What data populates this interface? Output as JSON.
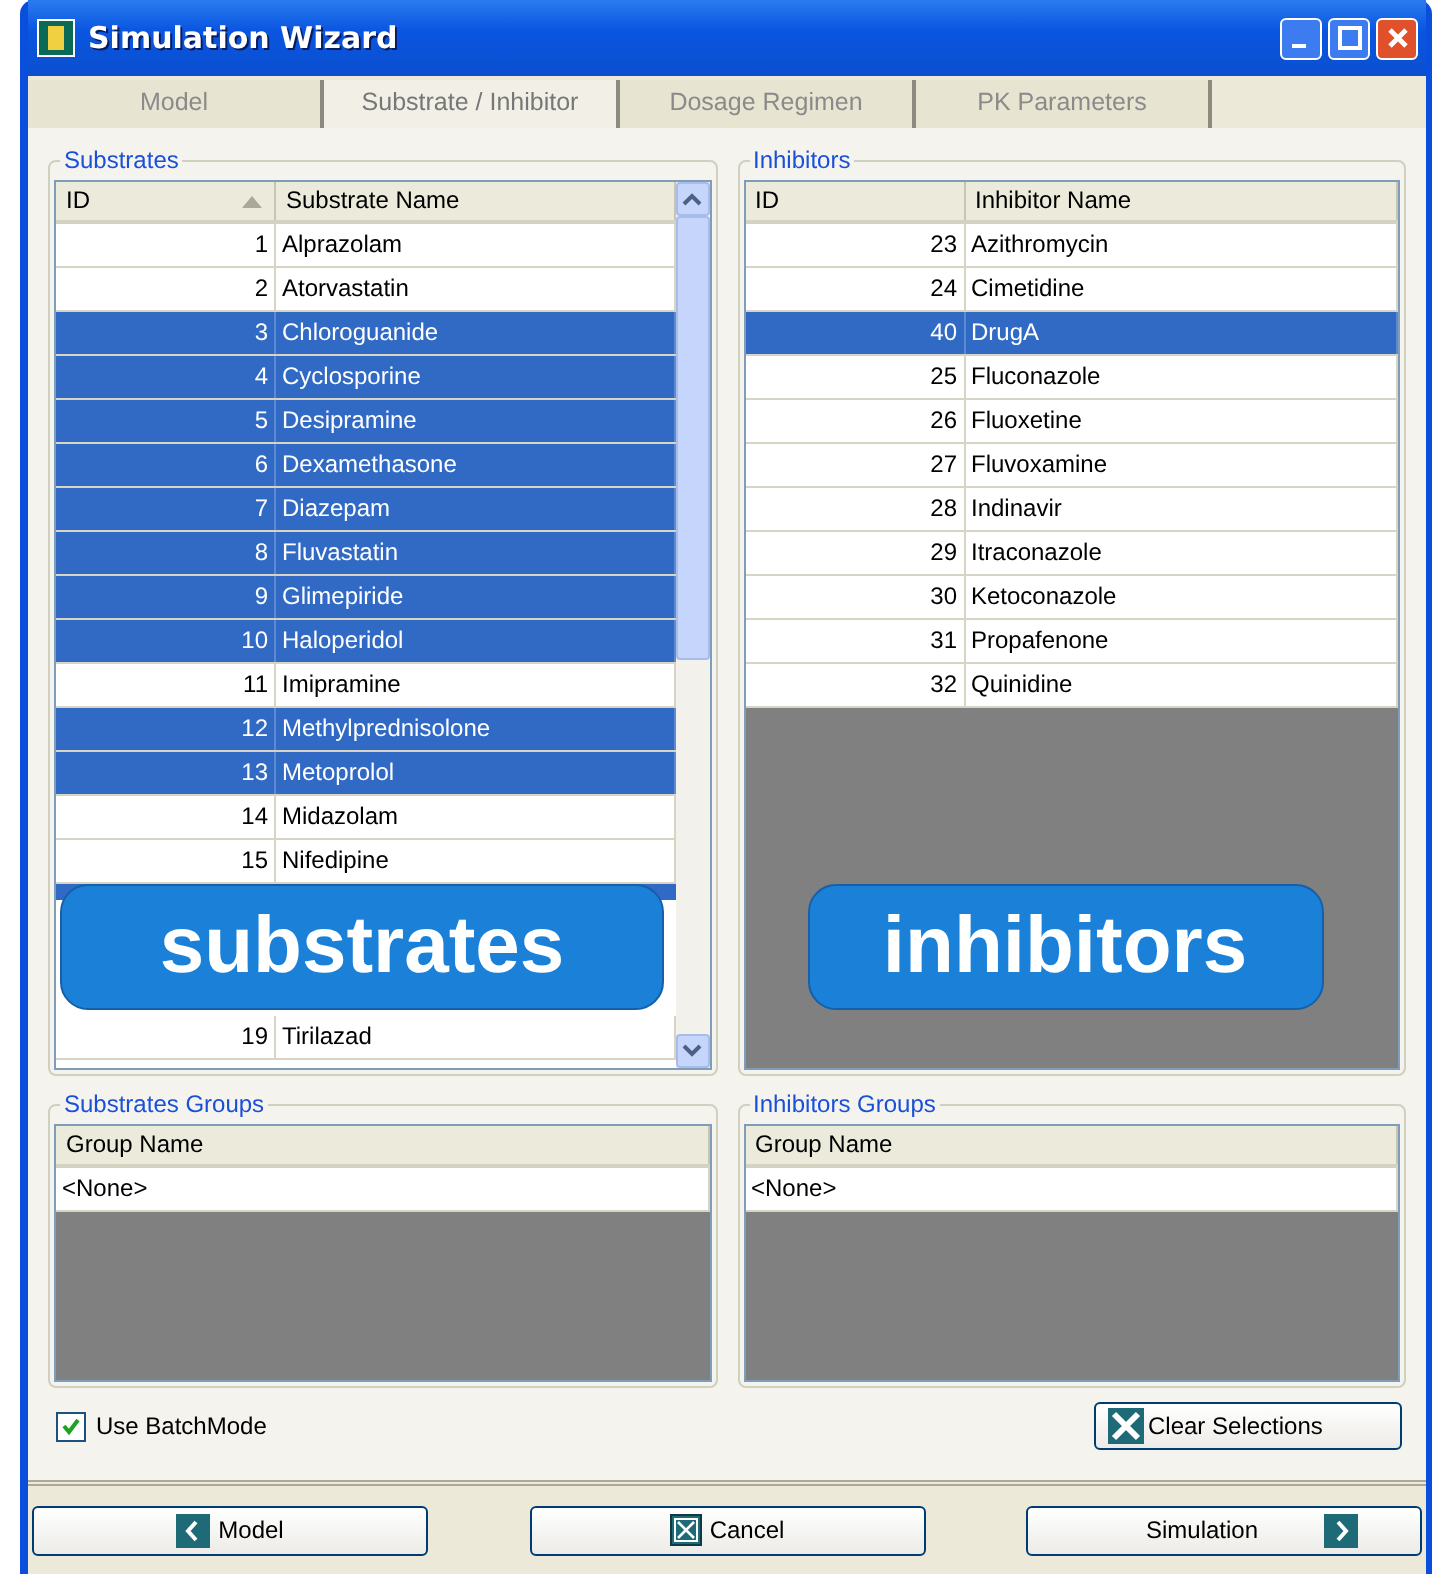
{
  "window": {
    "title": "Simulation Wizard"
  },
  "tabs": [
    {
      "label": "Model",
      "selected": false
    },
    {
      "label": "Substrate / Inhibitor",
      "selected": true
    },
    {
      "label": "Dosage Regimen",
      "selected": false
    },
    {
      "label": "PK Parameters",
      "selected": false
    }
  ],
  "substrates": {
    "title": "Substrates",
    "columns": [
      "ID",
      "Substrate Name"
    ],
    "rows": [
      {
        "id": "1",
        "name": "Alprazolam",
        "selected": false
      },
      {
        "id": "2",
        "name": "Atorvastatin",
        "selected": false
      },
      {
        "id": "3",
        "name": "Chloroguanide",
        "selected": true
      },
      {
        "id": "4",
        "name": "Cyclosporine",
        "selected": true
      },
      {
        "id": "5",
        "name": "Desipramine",
        "selected": true
      },
      {
        "id": "6",
        "name": "Dexamethasone",
        "selected": true
      },
      {
        "id": "7",
        "name": "Diazepam",
        "selected": true
      },
      {
        "id": "8",
        "name": "Fluvastatin",
        "selected": true
      },
      {
        "id": "9",
        "name": "Glimepiride",
        "selected": true
      },
      {
        "id": "10",
        "name": "Haloperidol",
        "selected": true
      },
      {
        "id": "11",
        "name": "Imipramine",
        "selected": false
      },
      {
        "id": "12",
        "name": "Methylprednisolone",
        "selected": true
      },
      {
        "id": "13",
        "name": "Metoprolol",
        "selected": true
      },
      {
        "id": "14",
        "name": "Midazolam",
        "selected": false
      },
      {
        "id": "15",
        "name": "Nifedipine",
        "selected": false
      }
    ],
    "rows_after_callout": [
      {
        "id": "19",
        "name": "Tirilazad",
        "selected": false
      }
    ]
  },
  "inhibitors": {
    "title": "Inhibitors",
    "columns": [
      "ID",
      "Inhibitor Name"
    ],
    "rows": [
      {
        "id": "23",
        "name": "Azithromycin",
        "selected": false
      },
      {
        "id": "24",
        "name": "Cimetidine",
        "selected": false
      },
      {
        "id": "40",
        "name": "DrugA",
        "selected": true
      },
      {
        "id": "25",
        "name": "Fluconazole",
        "selected": false
      },
      {
        "id": "26",
        "name": "Fluoxetine",
        "selected": false
      },
      {
        "id": "27",
        "name": "Fluvoxamine",
        "selected": false
      },
      {
        "id": "28",
        "name": "Indinavir",
        "selected": false
      },
      {
        "id": "29",
        "name": "Itraconazole",
        "selected": false
      },
      {
        "id": "30",
        "name": "Ketoconazole",
        "selected": false
      },
      {
        "id": "31",
        "name": "Propafenone",
        "selected": false
      },
      {
        "id": "32",
        "name": "Quinidine",
        "selected": false
      }
    ]
  },
  "substrates_groups": {
    "title": "Substrates Groups",
    "column": "Group Name",
    "rows": [
      "<None>"
    ]
  },
  "inhibitors_groups": {
    "title": "Inhibitors Groups",
    "column": "Group Name",
    "rows": [
      "<None>"
    ]
  },
  "use_batch_mode": {
    "label": "Use BatchMode",
    "checked": true
  },
  "clear_button": "Clear Selections",
  "callouts": [
    "substrates",
    "inhibitors"
  ],
  "footer": {
    "back": "Model",
    "cancel": "Cancel",
    "next": "Simulation"
  }
}
